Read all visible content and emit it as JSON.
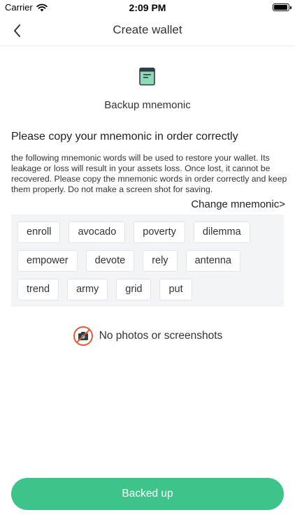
{
  "status_bar": {
    "carrier": "Carrier",
    "time": "2:09 PM"
  },
  "nav": {
    "title": "Create wallet",
    "back_icon": "chevron-left-icon"
  },
  "hero": {
    "icon": "book-icon",
    "label": "Backup mnemonic"
  },
  "heading": "Please copy your mnemonic in order correctly",
  "description": "the following mnemonic words will be used to restore your wallet. Its leakage or loss will result in your assets loss. Once lost, it cannot be recovered. Please copy the mnemonic words in order correctly and keep them properly. Do not make a screen shot for saving.",
  "change_link": "Change mnemonic>",
  "mnemonic_words": [
    "enroll",
    "avocado",
    "poverty",
    "dilemma",
    "empower",
    "devote",
    "rely",
    "antenna",
    "trend",
    "army",
    "grid",
    "put"
  ],
  "warning": {
    "icon": "no-camera-icon",
    "text": "No photos or screenshots"
  },
  "primary_button": {
    "label": "Backed up"
  },
  "colors": {
    "accent": "#3cc48a",
    "warning_red": "#e05a3a",
    "icon_green": "#8fd9b6",
    "word_box_bg": "#f3f4f6"
  }
}
